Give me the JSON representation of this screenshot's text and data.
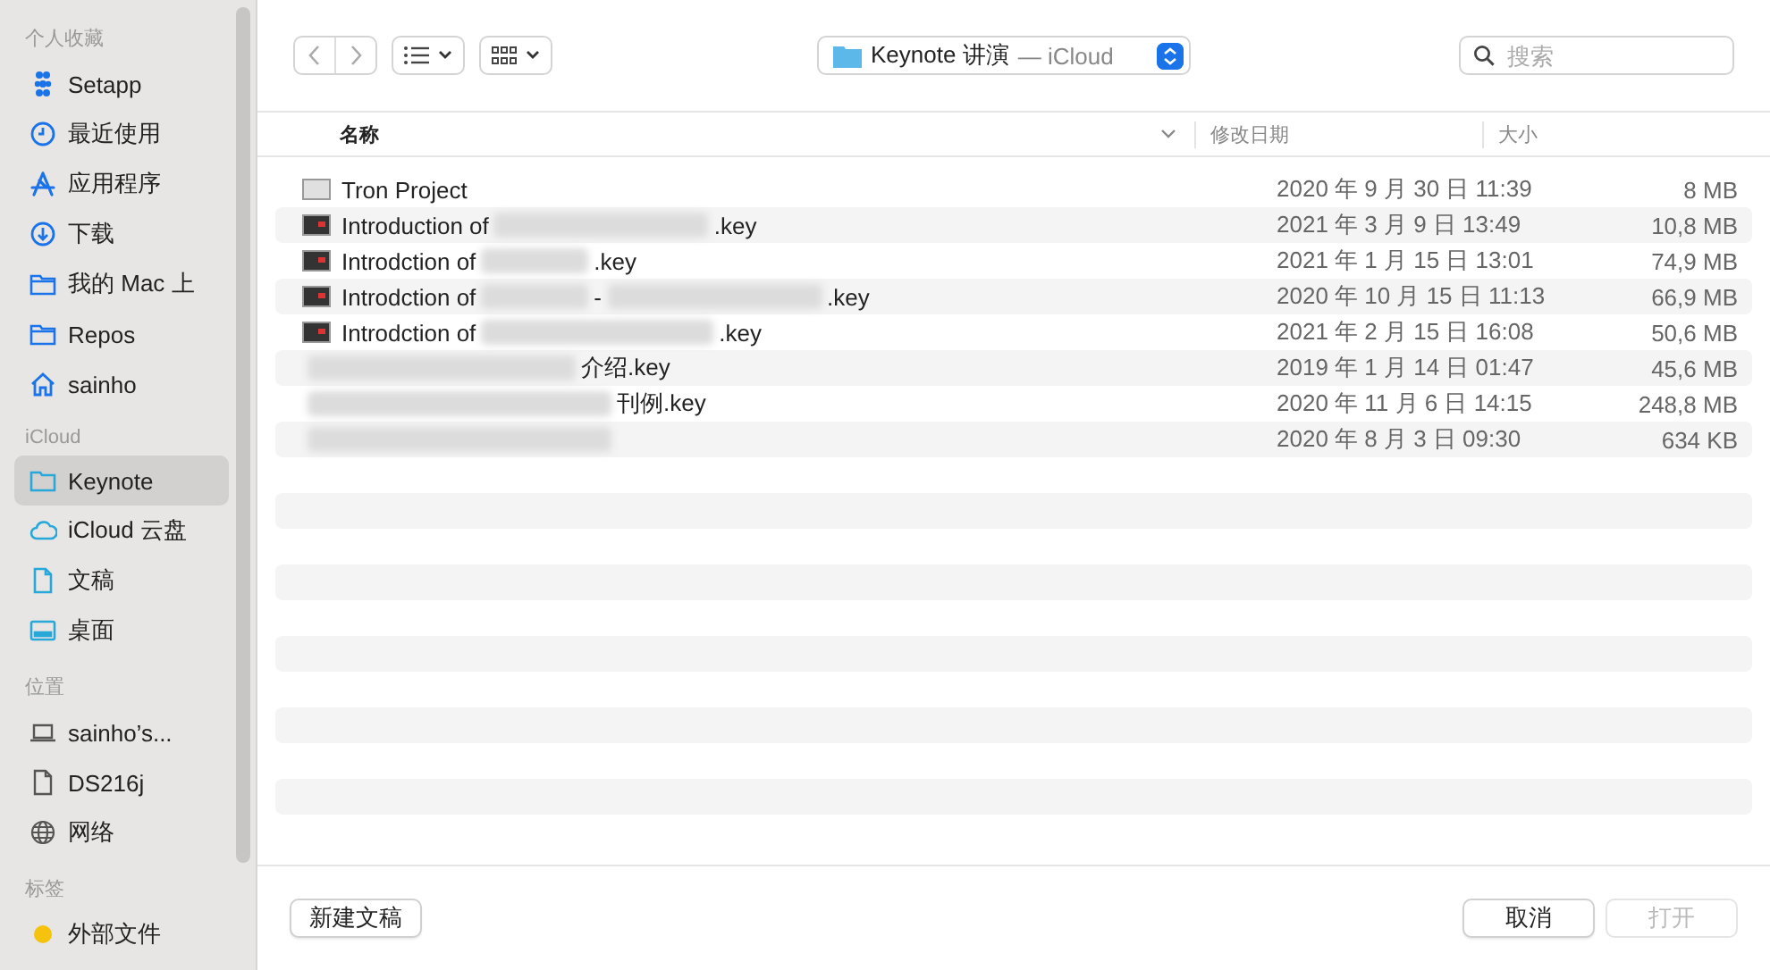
{
  "sidebar": {
    "sections": [
      {
        "title": "个人收藏",
        "items": [
          {
            "label": "Setapp",
            "selected": false
          },
          {
            "label": "最近使用",
            "selected": false
          },
          {
            "label": "应用程序",
            "selected": false
          },
          {
            "label": "下载",
            "selected": false
          },
          {
            "label": "我的 Mac 上",
            "selected": false
          },
          {
            "label": "Repos",
            "selected": false
          },
          {
            "label": "sainho",
            "selected": false
          }
        ]
      },
      {
        "title": "iCloud",
        "items": [
          {
            "label": "Keynote",
            "selected": true
          },
          {
            "label": "iCloud 云盘",
            "selected": false
          },
          {
            "label": "文稿",
            "selected": false
          },
          {
            "label": "桌面",
            "selected": false
          }
        ]
      },
      {
        "title": "位置",
        "items": [
          {
            "label": "sainho’s...",
            "selected": false
          },
          {
            "label": "DS216j",
            "selected": false
          },
          {
            "label": "网络",
            "selected": false
          }
        ]
      },
      {
        "title": "标签",
        "items": [
          {
            "label": "外部文件",
            "color": "#f5c20e",
            "selected": false
          }
        ]
      }
    ]
  },
  "toolbar": {
    "location": "Keynote 讲演",
    "location_suffix": "— iCloud",
    "search": {
      "placeholder": "搜索"
    }
  },
  "table": {
    "columns": [
      "名称",
      "修改日期",
      "大小"
    ],
    "rows": [
      {
        "kind": "project",
        "name": [
          {
            "kind": "text",
            "text": "Tron Project"
          }
        ],
        "date": "2020 年 9 月 30 日 11:39",
        "size": "8 MB"
      },
      {
        "kind": "keynote",
        "name": [
          {
            "kind": "text",
            "text": "Introduction of"
          },
          {
            "kind": "blur"
          },
          {
            "kind": "text",
            "text": ".key"
          }
        ],
        "date": "2021 年 3 月 9 日 13:49",
        "size": "10,8 MB"
      },
      {
        "kind": "keynote",
        "name": [
          {
            "kind": "text",
            "text": "Introdction of"
          },
          {
            "kind": "blur"
          },
          {
            "kind": "text",
            "text": ".key"
          }
        ],
        "date": "2021 年 1 月 15 日 13:01",
        "size": "74,9 MB"
      },
      {
        "kind": "keynote",
        "name": [
          {
            "kind": "text",
            "text": "Introdction of"
          },
          {
            "kind": "blur"
          },
          {
            "kind": "text",
            "text": "-"
          },
          {
            "kind": "blur"
          },
          {
            "kind": "text",
            "text": ".key"
          }
        ],
        "date": "2020 年 10 月 15 日 11:13",
        "size": "66,9 MB"
      },
      {
        "kind": "keynote",
        "name": [
          {
            "kind": "text",
            "text": "Introdction of"
          },
          {
            "kind": "blur"
          },
          {
            "kind": "text",
            "text": ".key"
          }
        ],
        "date": "2021 年 2 月 15 日 16:08",
        "size": "50,6 MB"
      },
      {
        "kind": "redacted",
        "name": [
          {
            "kind": "blur"
          },
          {
            "kind": "text",
            "text": "介绍.key"
          }
        ],
        "date": "2019 年 1 月 14 日 01:47",
        "size": "45,6 MB"
      },
      {
        "kind": "redacted",
        "name": [
          {
            "kind": "blur"
          },
          {
            "kind": "text",
            "text": "刊例.key"
          }
        ],
        "date": "2020 年 11 月 6 日 14:15",
        "size": "248,8 MB"
      },
      {
        "kind": "redacted",
        "name": [
          {
            "kind": "blur"
          }
        ],
        "date": "2020 年 8 月 3 日 09:30",
        "size": "634 KB"
      }
    ]
  },
  "footer": {
    "new_button": "新建文稿",
    "cancel_button": "取消",
    "open_button": {
      "label": "打开",
      "disabled": true
    }
  }
}
